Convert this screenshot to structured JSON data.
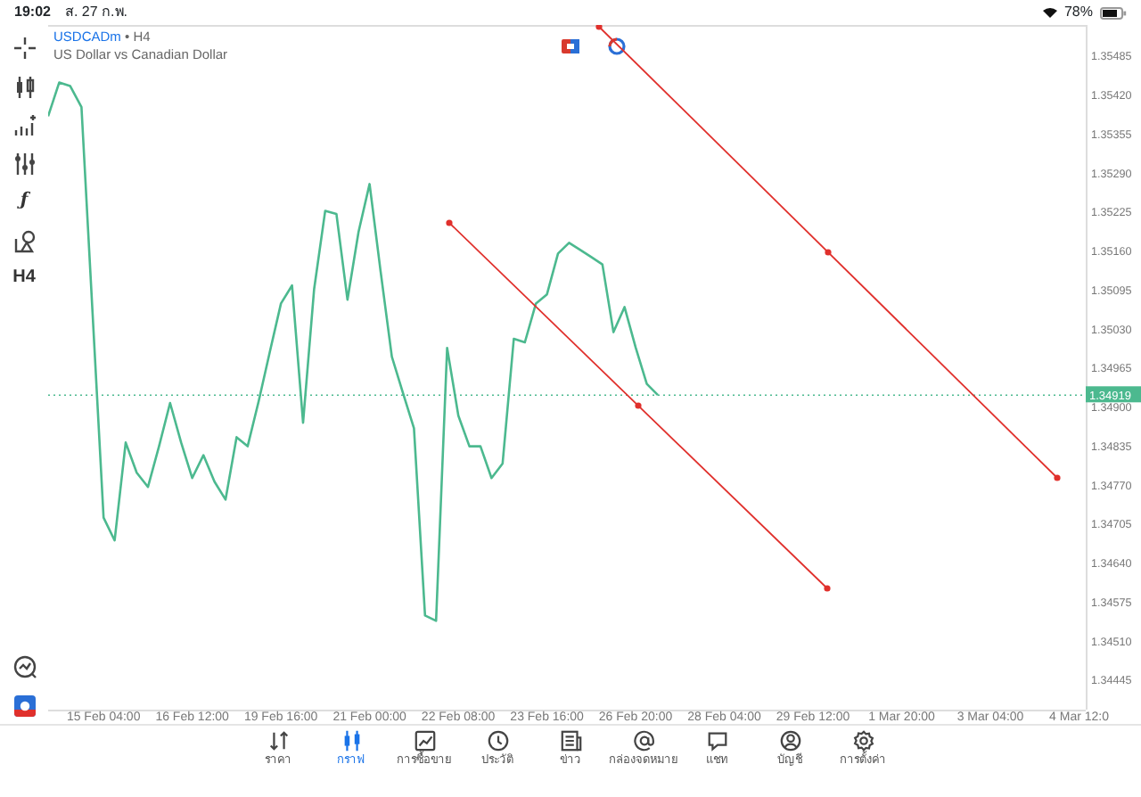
{
  "status_bar": {
    "time": "19:02",
    "date": "ส. 27 ก.พ.",
    "battery": "78%"
  },
  "toolbar": {
    "function_symbol": "ƒ",
    "timeframe": "H4"
  },
  "chart": {
    "bid_label": "1.34919",
    "separator": "•",
    "timeframe": "H4",
    "description": "US Dollar vs Canadian Dollar",
    "chart_data": {
      "type": "line",
      "ylim": [
        1.34395,
        1.35536
      ],
      "categories": [
        null,
        null,
        null,
        null,
        null,
        "15 Feb 04:00",
        null,
        null,
        null,
        null,
        null,
        null,
        null,
        "16 Feb 12:00",
        null,
        null,
        null,
        null,
        null,
        null,
        null,
        "19 Feb 16:00",
        null,
        null,
        null,
        null,
        null,
        null,
        null,
        "21 Feb 00:00",
        null,
        null,
        null,
        null,
        null,
        null,
        null,
        "22 Feb 08:00",
        null,
        null,
        null,
        null,
        null,
        null,
        null,
        "23 Feb 16:00",
        null,
        null,
        null,
        null,
        null,
        null,
        null,
        "26 Feb 20:00",
        null,
        null,
        null,
        null,
        null,
        null,
        null,
        "28 Feb 04:00",
        null,
        null,
        null,
        null,
        null,
        null,
        null,
        "29 Feb 12:00",
        null,
        null,
        null,
        null,
        null,
        null,
        null,
        "1 Mar 20:00",
        null,
        null,
        null,
        null,
        null,
        null,
        null,
        "3 Mar 04:00",
        null,
        null,
        null,
        null,
        null,
        null,
        null,
        "4 Mar 12:0"
      ],
      "series": [
        {
          "name": "USDCADm",
          "color": "#4cb98f",
          "values": [
            1.35384,
            1.3544,
            1.35434,
            1.35399,
            1.35057,
            1.34715,
            1.34677,
            1.3484,
            1.3479,
            1.34766,
            1.34834,
            1.34906,
            1.3484,
            1.34781,
            1.34819,
            1.34775,
            1.34745,
            1.34849,
            1.34834,
            1.34909,
            1.34992,
            1.35072,
            1.35102,
            1.34873,
            1.35096,
            1.35226,
            1.35221,
            1.35078,
            1.35191,
            1.35271,
            1.35125,
            1.34983,
            1.34923,
            1.34864,
            1.34552,
            1.34543,
            1.34998,
            1.34885,
            1.34834,
            1.34834,
            1.34781,
            1.34805,
            1.35013,
            1.35007,
            1.35072,
            1.35087,
            1.35155,
            1.35173,
            1.35161,
            1.35149,
            1.35137,
            1.35024,
            1.35066,
            1.34998,
            1.34938,
            1.34919,
            null,
            null,
            null,
            null,
            null,
            null,
            null,
            null,
            null,
            null,
            null,
            null,
            null,
            null,
            null,
            null,
            null,
            null,
            null,
            null,
            null,
            null,
            null,
            null,
            null,
            null,
            null,
            null,
            null,
            null,
            null,
            null,
            null,
            null,
            null,
            null,
            null,
            null
          ]
        }
      ],
      "yticks": [
        {
          "value": 1.35485,
          "label": "1.35485"
        },
        {
          "value": 1.3542,
          "label": "1.35420"
        },
        {
          "value": 1.35355,
          "label": "1.35355"
        },
        {
          "value": 1.3529,
          "label": "1.35290"
        },
        {
          "value": 1.35225,
          "label": "1.35225"
        },
        {
          "value": 1.3516,
          "label": "1.35160"
        },
        {
          "value": 1.35095,
          "label": "1.35095"
        },
        {
          "value": 1.3503,
          "label": "1.35030"
        },
        {
          "value": 1.34965,
          "label": "1.34965"
        },
        {
          "value": 1.349,
          "label": "1.34900"
        },
        {
          "value": 1.34835,
          "label": "1.34835"
        },
        {
          "value": 1.3477,
          "label": "1.34770"
        },
        {
          "value": 1.34705,
          "label": "1.34705"
        },
        {
          "value": 1.3464,
          "label": "1.34640"
        },
        {
          "value": 1.34575,
          "label": "1.34575"
        },
        {
          "value": 1.3451,
          "label": "1.34510"
        },
        {
          "value": 1.34445,
          "label": "1.34445"
        }
      ]
    }
  },
  "tabs": [
    {
      "label": "ราคา",
      "selected": false
    },
    {
      "label": "กราฟ",
      "selected": true
    },
    {
      "label": "การซื้อขาย",
      "selected": false
    },
    {
      "label": "ประวัติ",
      "selected": false
    },
    {
      "label": "ข่าว",
      "selected": false
    },
    {
      "label": "กล่องจดหมาย",
      "selected": false
    },
    {
      "label": "แชท",
      "selected": false
    },
    {
      "label": "บัญชี",
      "selected": false
    },
    {
      "label": "การตั้งค่า",
      "selected": false
    }
  ]
}
